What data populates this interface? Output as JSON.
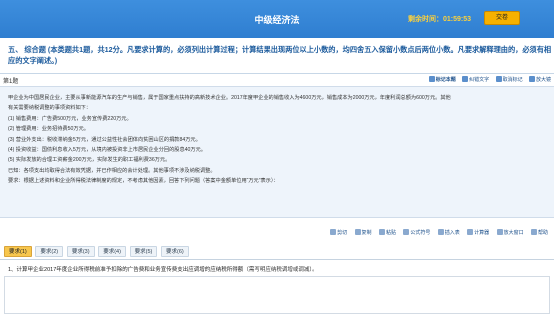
{
  "header": {
    "title": "中级经济法",
    "timer_label": "剩余时间：",
    "timer_value": "01:59:53",
    "submit_label": "交卷"
  },
  "question": {
    "heading": "五、 综合题 (本类题共1题，共12分。凡要求计算的，必须列出计算过程；计算结果出现两位以上小数的，均四舍五入保留小数点后两位小数。凡要求解释理由的，必须有相应的文字阐述。)",
    "number": "第1题",
    "tools": [
      "标记本题",
      "纠错文字",
      "取消标记",
      "放大镜"
    ]
  },
  "material": {
    "lines": [
      "甲企业为中国居民企业，主要从事新能源汽车的生产与销售，属于国家重点扶持的高新技术企业。2017年度甲企业的销售收入为4600万元，销售成本为2000万元，年度利润总额为600万元。其他",
      "有关需要纳税调整的事项资料如下：",
      "(1) 销售费用：广告费500万元，业务宣传费220万元。",
      "(2) 管理费用：业务招待费50万元。",
      "(3) 营业外支出：税收滞纳金5万元，通过公益性社会团体向贫困山区的捐款84万元。",
      "(4) 投资收益：国债利息收入5万元，从境内被投资非上市居民企业分回的股息40万元。",
      "(5) 实际发放的合理工资薪金200万元，实际发生的职工福利费36万元。",
      "已知：各项支出均取得合法有效凭据，并已作相应的会计处理。其他事项不涉及纳税调整。",
      "要求：根据上述资料和企业所得税法律制度的规定，不考虑其他因素，回答下列问题（答案中金额单位用“万元”表示）："
    ]
  },
  "editor_toolbar": [
    "剪切",
    "复制",
    "粘贴",
    "公式符号",
    "插入表",
    "计算器",
    "放大窗口",
    "帮助"
  ],
  "tabs": [
    "要求(1)",
    "要求(2)",
    "要求(3)",
    "要求(4)",
    "要求(5)",
    "要求(6)"
  ],
  "answer": {
    "requirement": "1、计算甲企业2017年度企业所得税前准予扣除的广告费和业务宣传费支出应调增的应纳税所得额",
    "hint": "（需写明应纳税调增或调减）。"
  },
  "colors": {
    "topbar": "#2f7ed0",
    "timer": "#ffd23a",
    "submit": "#f6b100",
    "active_tab": "#f7c64d",
    "material_bg": "#eef4fb"
  }
}
